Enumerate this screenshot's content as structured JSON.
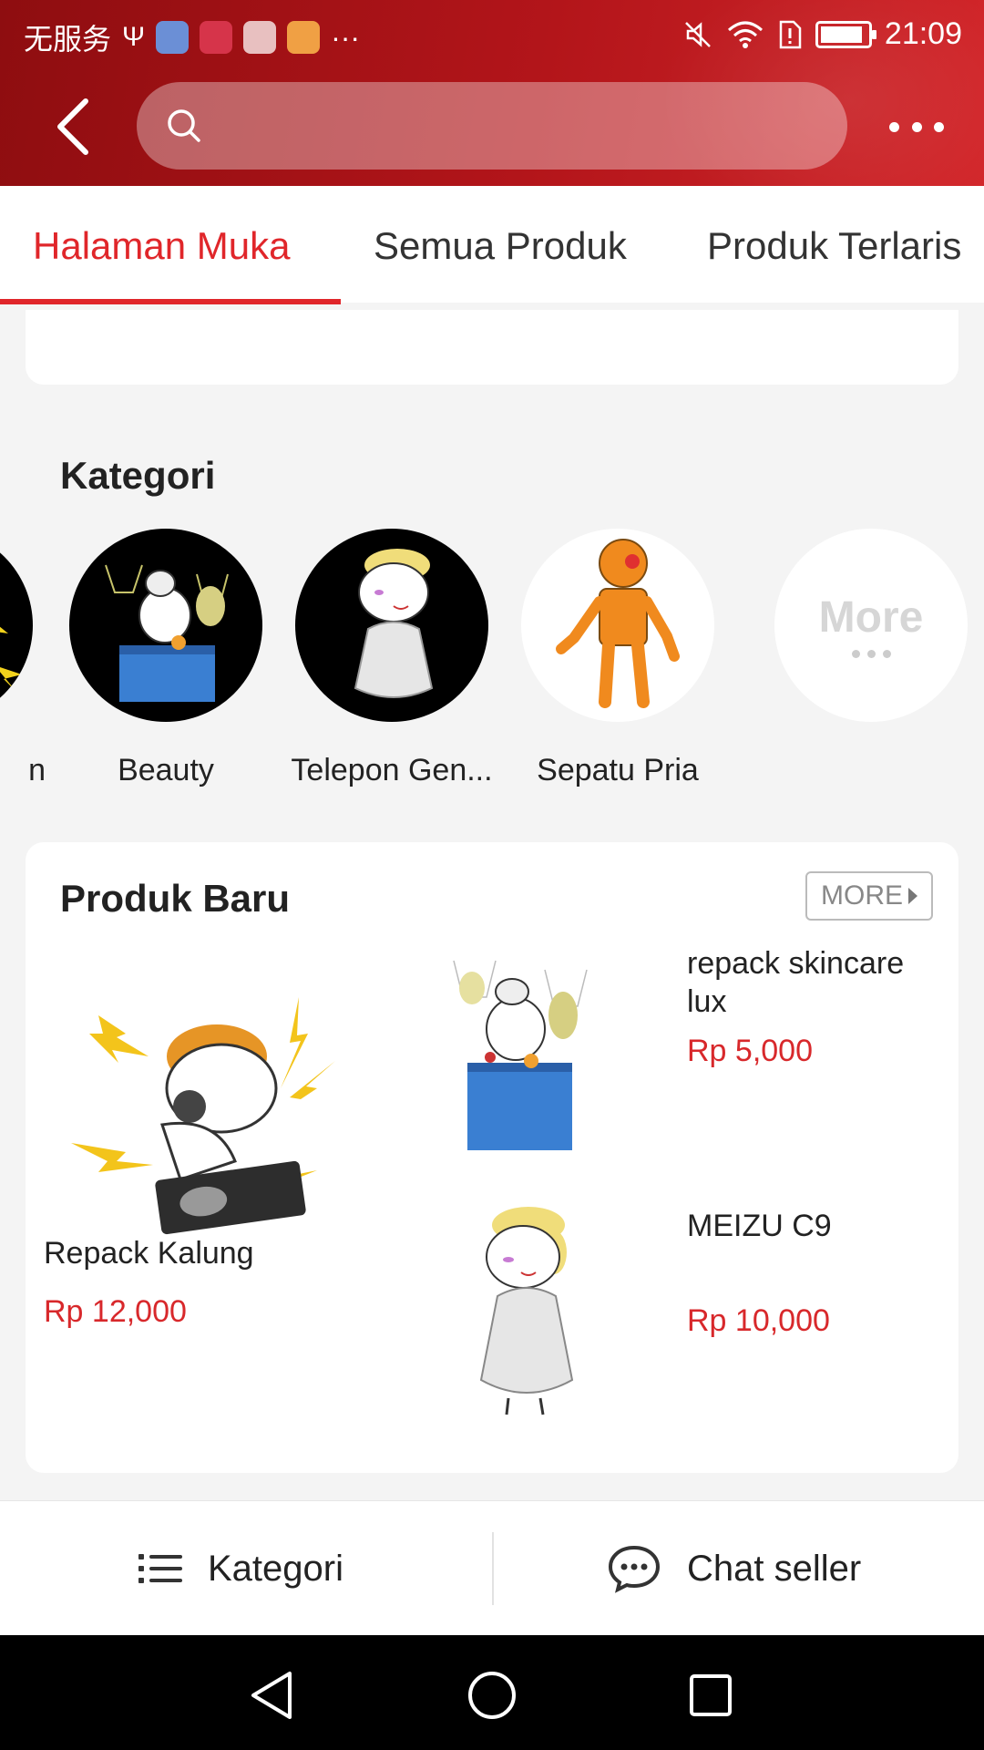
{
  "status_bar": {
    "carrier": "无服务",
    "overflow": "···",
    "time": "21:09",
    "battery_level": 0.9
  },
  "search": {
    "placeholder": ""
  },
  "tabs": [
    {
      "label": "Halaman Muka",
      "active": true
    },
    {
      "label": "Semua Produk",
      "active": false
    },
    {
      "label": "Produk Terlaris",
      "active": false
    }
  ],
  "kategori": {
    "title": "Kategori",
    "items": [
      {
        "label": "n"
      },
      {
        "label": "Beauty"
      },
      {
        "label": "Telepon Gen..."
      },
      {
        "label": "Sepatu Pria"
      },
      {
        "label": "",
        "more_text": "More"
      }
    ]
  },
  "produk_baru": {
    "title": "Produk Baru",
    "more_label": "MORE",
    "products": [
      {
        "name": "Repack Kalung",
        "price": "Rp 12,000"
      },
      {
        "name": "repack skincare lux",
        "price": "Rp 5,000"
      },
      {
        "name": "MEIZU C9",
        "price": "Rp 10,000"
      }
    ]
  },
  "bottom_bar": {
    "kategori_label": "Kategori",
    "chat_label": "Chat seller"
  },
  "colors": {
    "header": "#b3151a",
    "accent": "#e0262a",
    "price": "#d8282b"
  }
}
